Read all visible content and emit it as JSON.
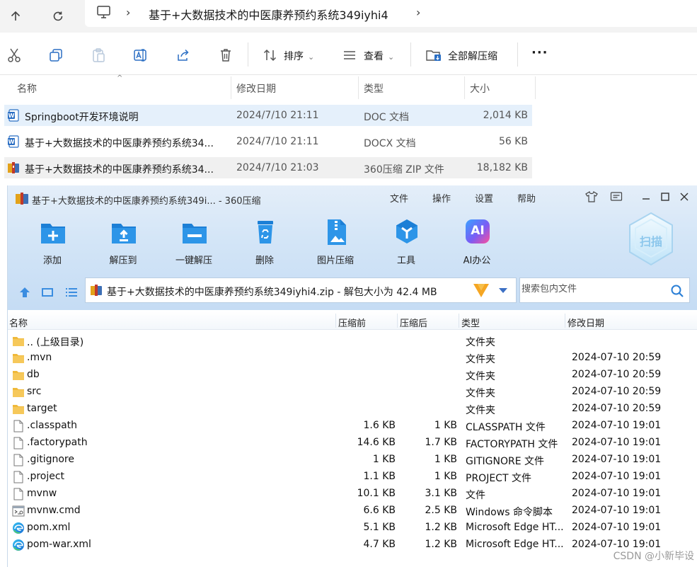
{
  "explorer": {
    "address_path": "基于+大数据技术的中医康养预约系统349iyhi4",
    "toolbar": {
      "sort_label": "排序",
      "view_label": "查看",
      "extract_all_label": "全部解压缩"
    },
    "columns": {
      "name": "名称",
      "date": "修改日期",
      "type": "类型",
      "size": "大小"
    },
    "files": [
      {
        "name": "Springboot开发环境说明",
        "date": "2024/7/10 21:11",
        "type": "DOC 文档",
        "size": "2,014 KB",
        "icon": "word-doc-icon"
      },
      {
        "name": "基于+大数据技术的中医康养预约系统34...",
        "date": "2024/7/10 21:11",
        "type": "DOCX 文档",
        "size": "56 KB",
        "icon": "word-doc-icon"
      },
      {
        "name": "基于+大数据技术的中医康养预约系统34...",
        "date": "2024/7/10 21:03",
        "type": "360压缩 ZIP 文件",
        "size": "18,182 KB",
        "icon": "zip-archive-icon"
      }
    ]
  },
  "zip": {
    "title": "基于+大数据技术的中医康养预约系统349i... - 360压缩",
    "menu": [
      "文件",
      "操作",
      "设置",
      "帮助"
    ],
    "tools": [
      {
        "label": "添加",
        "icon": "add-icon"
      },
      {
        "label": "解压到",
        "icon": "extract-to-icon"
      },
      {
        "label": "一键解压",
        "icon": "one-click-extract-icon"
      },
      {
        "label": "删除",
        "icon": "delete-icon"
      },
      {
        "label": "图片压缩",
        "icon": "image-compress-icon"
      },
      {
        "label": "工具",
        "icon": "tools-icon"
      },
      {
        "label": "AI办公",
        "icon": "ai-office-icon"
      }
    ],
    "ai_badge": "AI",
    "scan_label": "扫描",
    "path_text": "基于+大数据技术的中医康养预约系统349iyhi4.zip - 解包大小为 42.4 MB",
    "search_placeholder": "搜索包内文件",
    "columns": {
      "name": "名称",
      "compressed_before": "压缩前",
      "compressed_after": "压缩后",
      "type": "类型",
      "date": "修改日期"
    },
    "entries": [
      {
        "name": ".. (上级目录)",
        "before": "",
        "after": "",
        "type": "文件夹",
        "date": "",
        "icon": "folder-icon"
      },
      {
        "name": ".mvn",
        "before": "",
        "after": "",
        "type": "文件夹",
        "date": "2024-07-10 20:59",
        "icon": "folder-icon"
      },
      {
        "name": "db",
        "before": "",
        "after": "",
        "type": "文件夹",
        "date": "2024-07-10 20:59",
        "icon": "folder-icon"
      },
      {
        "name": "src",
        "before": "",
        "after": "",
        "type": "文件夹",
        "date": "2024-07-10 20:59",
        "icon": "folder-icon"
      },
      {
        "name": "target",
        "before": "",
        "after": "",
        "type": "文件夹",
        "date": "2024-07-10 20:59",
        "icon": "folder-icon"
      },
      {
        "name": ".classpath",
        "before": "1.6 KB",
        "after": "1 KB",
        "type": "CLASSPATH 文件",
        "date": "2024-07-10 19:01",
        "icon": "file-icon"
      },
      {
        "name": ".factorypath",
        "before": "14.6 KB",
        "after": "1.7 KB",
        "type": "FACTORYPATH 文件",
        "date": "2024-07-10 19:01",
        "icon": "file-icon"
      },
      {
        "name": ".gitignore",
        "before": "1 KB",
        "after": "1 KB",
        "type": "GITIGNORE 文件",
        "date": "2024-07-10 19:01",
        "icon": "file-icon"
      },
      {
        "name": ".project",
        "before": "1.1 KB",
        "after": "1 KB",
        "type": "PROJECT 文件",
        "date": "2024-07-10 19:01",
        "icon": "file-icon"
      },
      {
        "name": "mvnw",
        "before": "10.1 KB",
        "after": "3.1 KB",
        "type": "文件",
        "date": "2024-07-10 19:01",
        "icon": "file-icon"
      },
      {
        "name": "mvnw.cmd",
        "before": "6.6 KB",
        "after": "2.5 KB",
        "type": "Windows 命令脚本",
        "date": "2024-07-10 19:01",
        "icon": "cmd-script-icon"
      },
      {
        "name": "pom.xml",
        "before": "5.1 KB",
        "after": "1.2 KB",
        "type": "Microsoft Edge HT...",
        "date": "2024-07-10 19:01",
        "icon": "edge-icon"
      },
      {
        "name": "pom-war.xml",
        "before": "4.7 KB",
        "after": "1.2 KB",
        "type": "Microsoft Edge HT...",
        "date": "2024-07-10 19:01",
        "icon": "edge-icon"
      }
    ]
  },
  "watermark": "CSDN @小新毕设"
}
